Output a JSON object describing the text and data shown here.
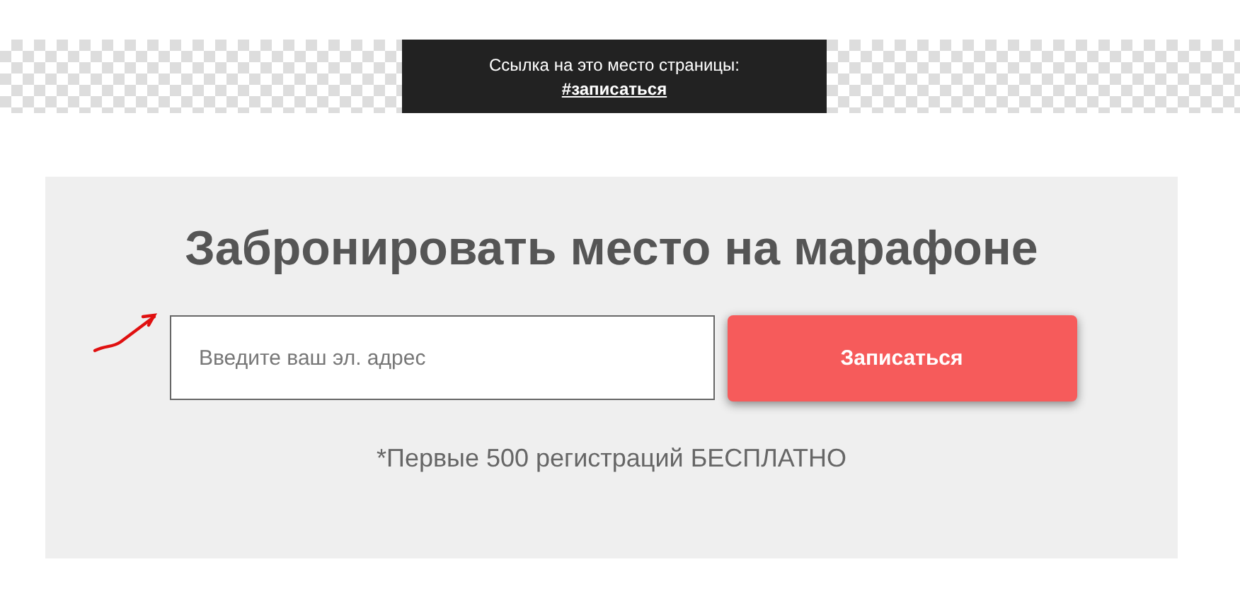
{
  "anchor_tooltip": {
    "caption": "Ссылка на это место страницы:",
    "link": "#записаться"
  },
  "form": {
    "title": "Забронировать место на марафоне",
    "email": {
      "placeholder": "Введите ваш эл. адрес"
    },
    "button": "Записаться",
    "note": "*Первые 500 регистраций БЕСПЛАТНО"
  }
}
